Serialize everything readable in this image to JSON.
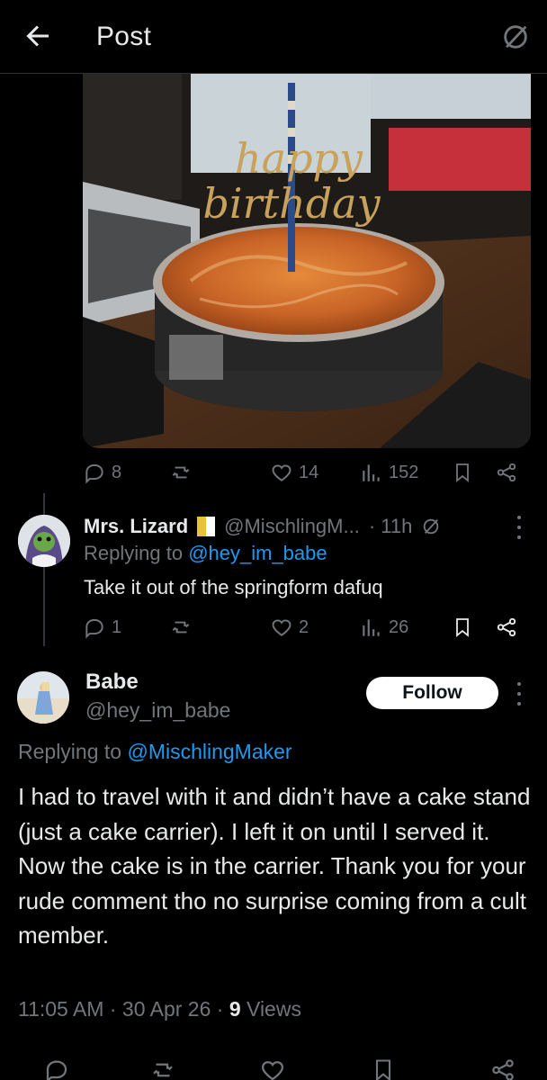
{
  "header": {
    "title": "Post",
    "back_icon": "arrow-left-icon",
    "right_icon": "slashed-circle-icon"
  },
  "original_post": {
    "image_alt_icon": "photo",
    "topper_text": "happy birthday",
    "stats": {
      "replies": "8",
      "retweets": "",
      "likes": "14",
      "views": "152"
    }
  },
  "reply": {
    "display_name": "Mrs. Lizard",
    "handle": "@MischlingM...",
    "time": "· 11h",
    "replying_label": "Replying to ",
    "replying_handle": "@hey_im_babe",
    "text": "Take it out of the springform dafuq",
    "stats": {
      "replies": "1",
      "likes": "2",
      "views": "26"
    }
  },
  "main": {
    "display_name": "Babe",
    "handle": "@hey_im_babe",
    "follow_label": "Follow",
    "replying_label": "Replying to ",
    "replying_handle": "@MischlingMaker",
    "text": "I had to travel with it and didn’t have a cake stand (just a cake carrier). I left it on until I served it. Now the cake is in the carrier. Thank you for your rude comment tho no surprise coming from a cult member.",
    "time": "11:05 AM · 30 Apr 26 · ",
    "views_count": "9",
    "views_label": " Views"
  },
  "colors": {
    "background": "#000000",
    "text": "#e7e9ea",
    "muted": "#71767b",
    "link": "#1d9bf0"
  }
}
